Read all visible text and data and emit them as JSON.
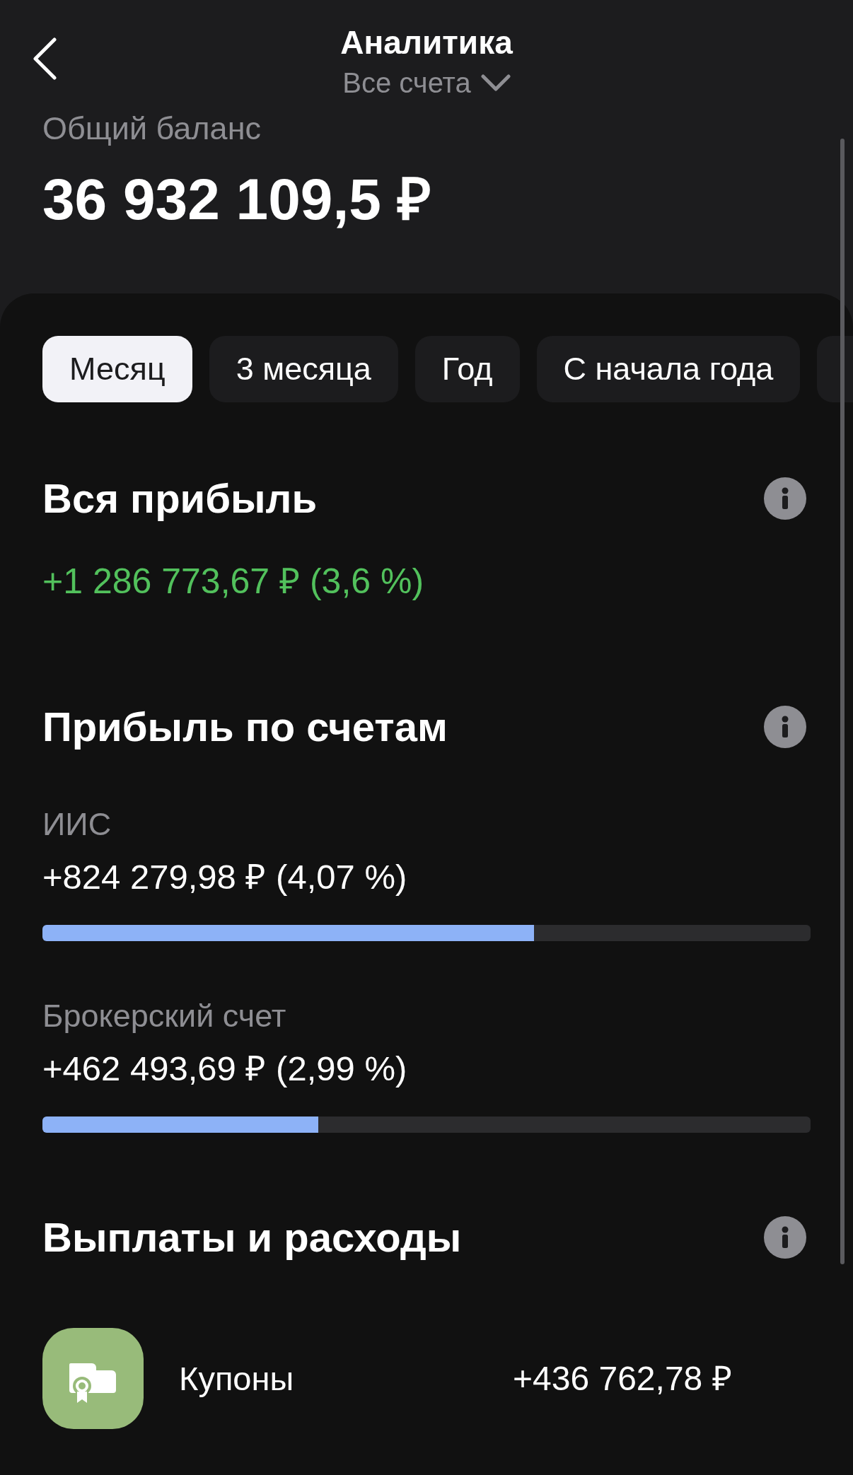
{
  "nav": {
    "title": "Аналитика",
    "account_picker": "Все счета"
  },
  "balance": {
    "label": "Общий баланс",
    "value": "36 932 109,5 ₽"
  },
  "period_tabs": [
    {
      "label": "Месяц",
      "selected": true
    },
    {
      "label": "3 месяца",
      "selected": false
    },
    {
      "label": "Год",
      "selected": false
    },
    {
      "label": "С начала года",
      "selected": false
    },
    {
      "selected": false
    }
  ],
  "total_profit": {
    "title": "Вся прибыль",
    "value": "+1 286 773,67 ₽ (3,6 %)"
  },
  "profit_by_account": {
    "title": "Прибыль по счетам",
    "accounts": [
      {
        "name": "ИИС",
        "value": "+824 279,98 ₽ (4,07 %)",
        "level": 0.64
      },
      {
        "name": "Брокерский счет",
        "value": "+462 493,69 ₽ (2,99 %)",
        "level": 0.359
      }
    ]
  },
  "payouts": {
    "title": "Выплаты и расходы",
    "items": [
      {
        "name": "Купоны",
        "value": "+436 762,78 ₽"
      }
    ]
  }
}
